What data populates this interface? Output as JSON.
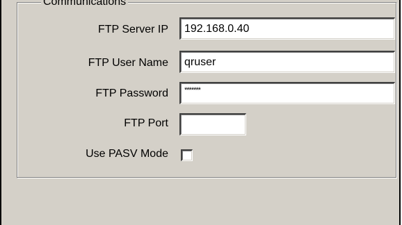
{
  "group": {
    "title": "Communications"
  },
  "fields": {
    "server_ip": {
      "label": "FTP Server IP",
      "value": "192.168.0.40"
    },
    "user_name": {
      "label": "FTP User Name",
      "value": "qruser"
    },
    "password": {
      "label": "FTP Password",
      "value": "*******"
    },
    "port": {
      "label": "FTP Port",
      "value": ""
    },
    "pasv": {
      "label": "Use PASV Mode",
      "checked": false
    }
  }
}
